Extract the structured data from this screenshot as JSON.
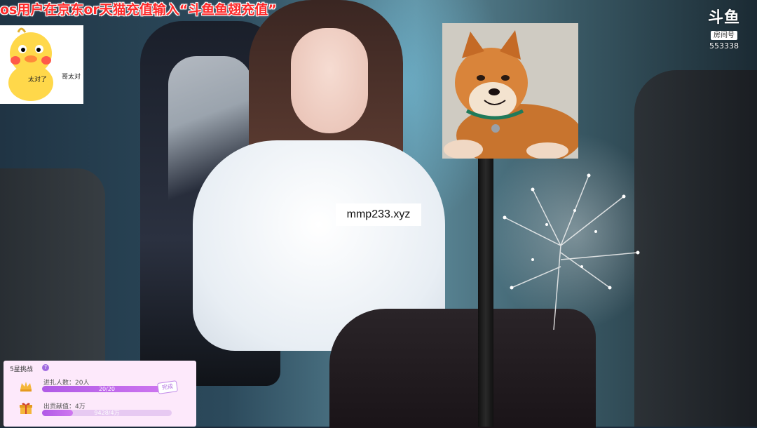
{
  "banner": {
    "text": "os用户在京东or天猫充值输入“斗鱼鱼翅充值”"
  },
  "sticker": {
    "text_left": "太对了",
    "text_right": "哥太对"
  },
  "watermark": {
    "text": "mmp233.xyz"
  },
  "douyu": {
    "brand": "斗鱼",
    "room_tag": "房间号",
    "room_number": "553338"
  },
  "challenge": {
    "title": "5星挑战",
    "help_icon": "question-icon",
    "rows": [
      {
        "icon": "crown-icon",
        "label": "进扎人数：20人",
        "progress_text": "20/20",
        "progress": 1.0,
        "badge": "完成"
      },
      {
        "icon": "gift-icon",
        "label": "出贡献值：4万",
        "progress_text": "9428/4万",
        "progress": 0.24
      }
    ]
  },
  "colors": {
    "banner_red": "#ff2a2a",
    "challenge_bg": "#fde9fb",
    "progress_purple": "#b05ae6"
  }
}
